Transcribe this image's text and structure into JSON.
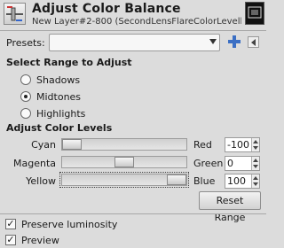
{
  "header": {
    "title": "Adjust Color Balance",
    "subtitle": "New Layer#2-800 (SecondLensFlareColorLevelle..."
  },
  "presets": {
    "label": "Presets:",
    "value": ""
  },
  "range": {
    "heading": "Select Range to Adjust",
    "options": [
      {
        "label": "Shadows",
        "selected": false
      },
      {
        "label": "Midtones",
        "selected": true
      },
      {
        "label": "Highlights",
        "selected": false
      }
    ]
  },
  "levels": {
    "heading": "Adjust Color Levels",
    "rows": [
      {
        "left": "Cyan",
        "right": "Red",
        "value": "-100",
        "slider_fraction": 0.0
      },
      {
        "left": "Magenta",
        "right": "Green",
        "value": "0",
        "slider_fraction": 0.5
      },
      {
        "left": "Yellow",
        "right": "Blue",
        "value": "100",
        "slider_fraction": 1.0
      }
    ],
    "reset_label": "Reset Range"
  },
  "options": {
    "preserve_luminosity": {
      "label": "Preserve luminosity",
      "checked": true
    },
    "preview": {
      "label": "Preview",
      "checked": true
    }
  },
  "icons": {
    "tool": "color-balance-icon",
    "add": "plus-icon",
    "menu": "menu-icon"
  },
  "colors": {
    "plus": "#3b6fc4"
  }
}
